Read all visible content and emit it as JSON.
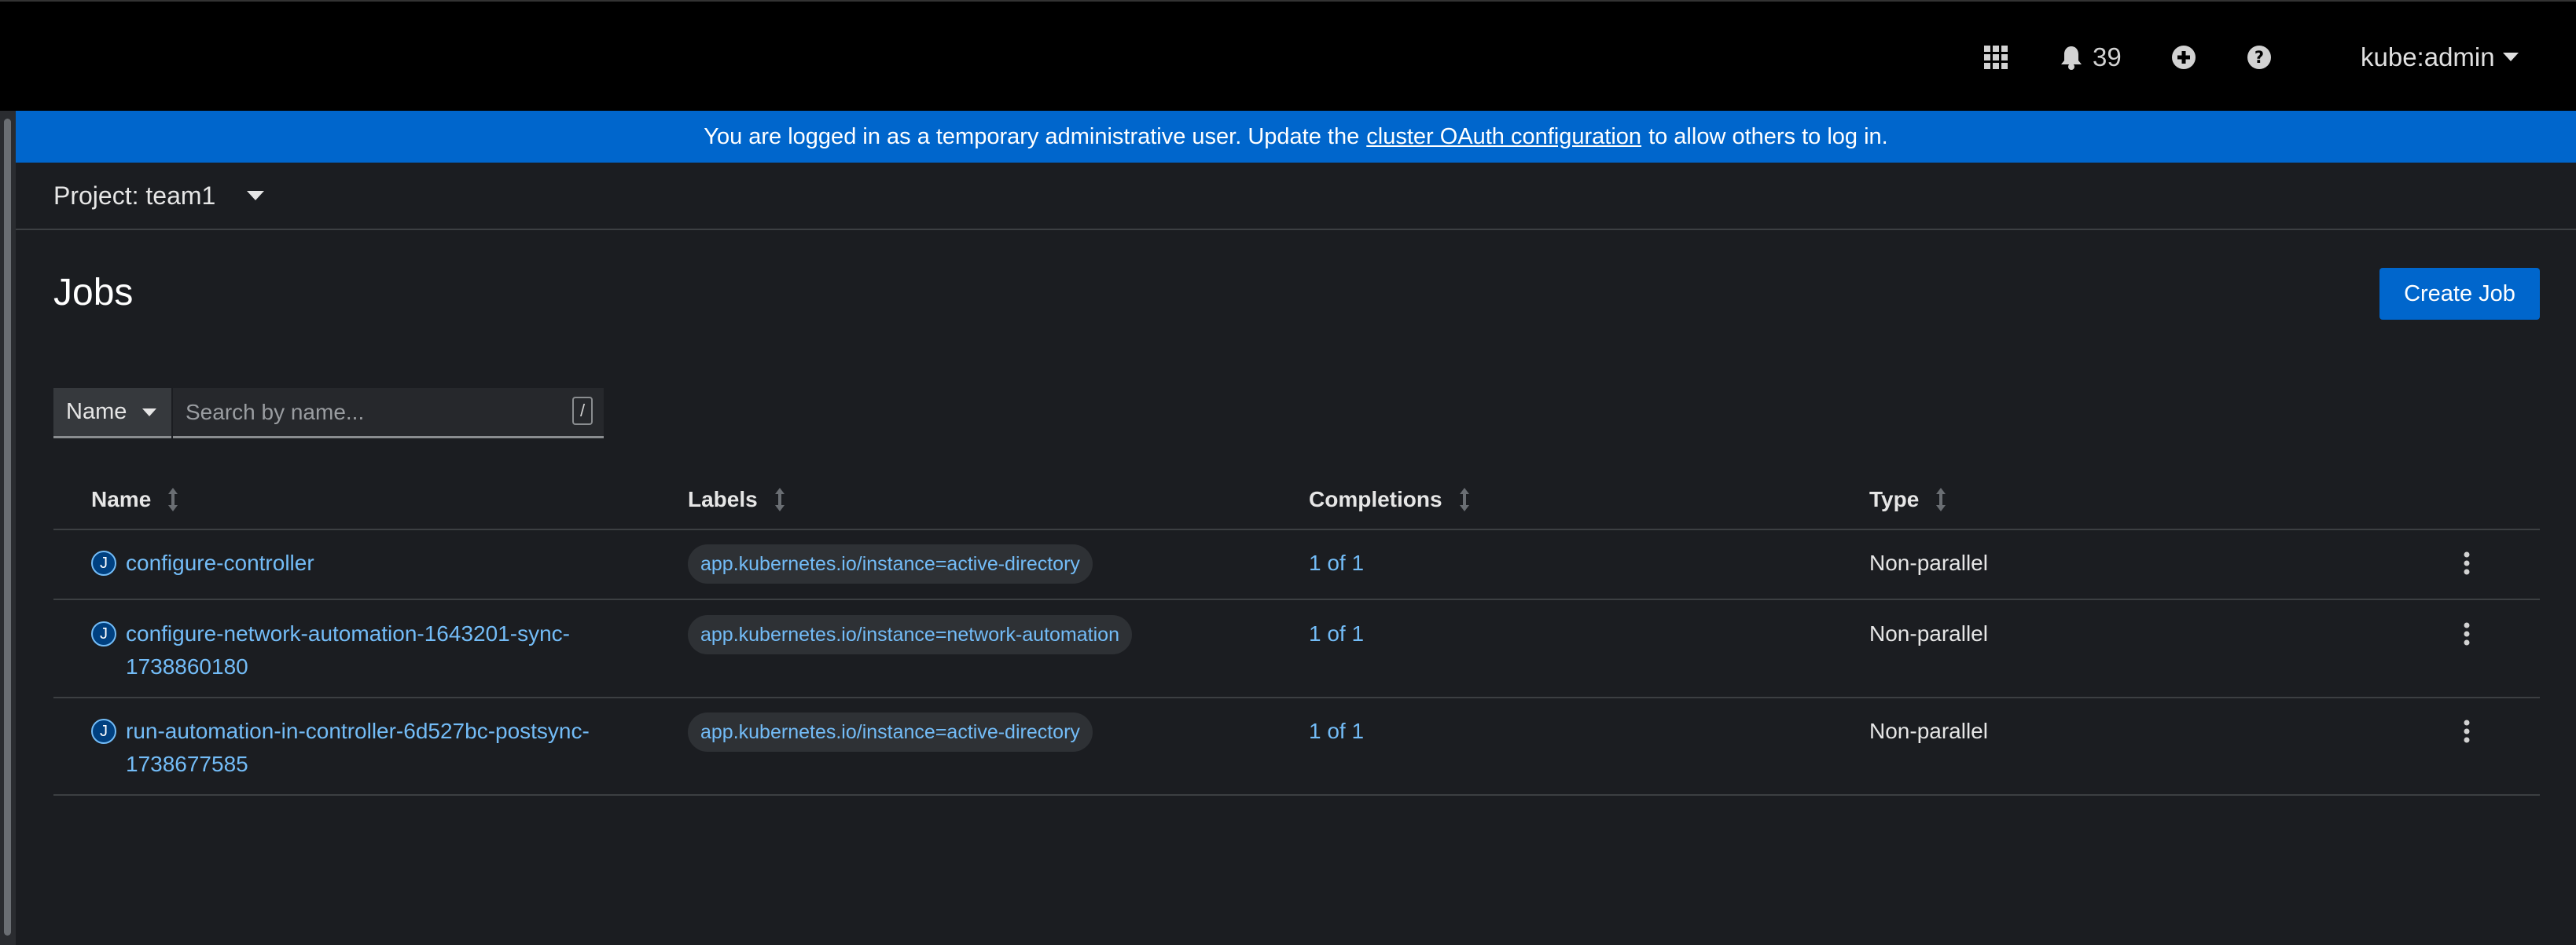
{
  "masthead": {
    "notification_count": "39",
    "user": "kube:admin",
    "icons": [
      "app-launcher-grid-icon",
      "bell-icon",
      "plus-circle-icon",
      "question-circle-icon"
    ]
  },
  "banner": {
    "text_before": "You are logged in as a temporary administrative user. Update the",
    "link": "cluster OAuth configuration",
    "text_after": "to allow others to log in."
  },
  "project": {
    "label": "Project: team1"
  },
  "page": {
    "title": "Jobs",
    "create_button": "Create Job"
  },
  "filter": {
    "type": "Name",
    "placeholder": "Search by name...",
    "shortcut": "/"
  },
  "table": {
    "headers": {
      "name": "Name",
      "labels": "Labels",
      "completions": "Completions",
      "type": "Type"
    },
    "rows": [
      {
        "icon": "J",
        "name_line1": "configure-controller",
        "name_line2": "",
        "label": "app.kubernetes.io/instance=active-directory",
        "completions": "1 of 1",
        "type": "Non-parallel"
      },
      {
        "icon": "J",
        "name_line1": "configure-network-automation-1643201-sync-",
        "name_line2": "1738860180",
        "label": "app.kubernetes.io/instance=network-automation",
        "completions": "1 of 1",
        "type": "Non-parallel"
      },
      {
        "icon": "J",
        "name_line1": "run-automation-in-controller-6d527bc-postsync-",
        "name_line2": "1738677585",
        "label": "app.kubernetes.io/instance=active-directory",
        "completions": "1 of 1",
        "type": "Non-parallel"
      }
    ]
  },
  "colors": {
    "accent": "#0066cc",
    "link": "#73bcf7",
    "masthead": "#000000",
    "background": "#1b1d21"
  }
}
